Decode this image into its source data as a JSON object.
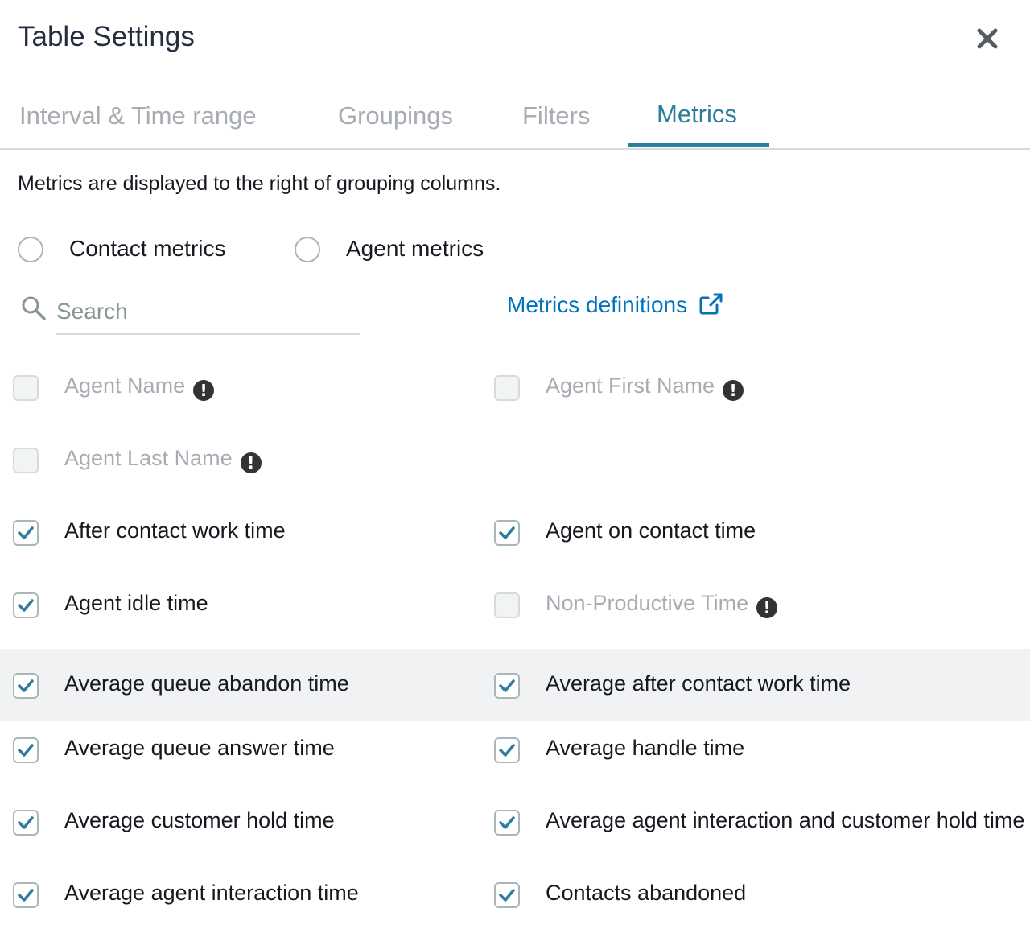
{
  "modal": {
    "title": "Table Settings",
    "close_icon": "close-icon"
  },
  "tabs": [
    {
      "label": "Interval & Time range",
      "active": false
    },
    {
      "label": "Groupings",
      "active": false
    },
    {
      "label": "Filters",
      "active": false
    },
    {
      "label": "Metrics",
      "active": true
    }
  ],
  "description": "Metrics are displayed to the right of grouping columns.",
  "metric_type": {
    "options": [
      {
        "label": "Contact metrics",
        "selected": false
      },
      {
        "label": "Agent metrics",
        "selected": false
      }
    ]
  },
  "search": {
    "placeholder": "Search",
    "value": ""
  },
  "definitions_link": {
    "label": "Metrics definitions",
    "icon": "external-link-icon"
  },
  "metrics": [
    {
      "label": "Agent Name",
      "checked": false,
      "disabled": true,
      "warning": true
    },
    {
      "label": "Agent First Name",
      "checked": false,
      "disabled": true,
      "warning": true
    },
    {
      "label": "Agent Last Name",
      "checked": false,
      "disabled": true,
      "warning": true
    },
    {
      "label": "After contact work time",
      "checked": true,
      "disabled": false,
      "warning": false
    },
    {
      "label": "Agent on contact time",
      "checked": true,
      "disabled": false,
      "warning": false
    },
    {
      "label": "Agent idle time",
      "checked": true,
      "disabled": false,
      "warning": false
    },
    {
      "label": "Non-Productive Time",
      "checked": false,
      "disabled": true,
      "warning": true
    },
    {
      "label": "Average queue abandon time",
      "checked": true,
      "disabled": false,
      "warning": false
    },
    {
      "label": "Average after contact work time",
      "checked": true,
      "disabled": false,
      "warning": false
    },
    {
      "label": "Average queue answer time",
      "checked": true,
      "disabled": false,
      "warning": false
    },
    {
      "label": "Average handle time",
      "checked": true,
      "disabled": false,
      "warning": false
    },
    {
      "label": "Average customer hold time",
      "checked": true,
      "disabled": false,
      "warning": false
    },
    {
      "label": "Average agent interaction and customer hold time",
      "checked": true,
      "disabled": false,
      "warning": false
    },
    {
      "label": "Average agent interaction time",
      "checked": true,
      "disabled": false,
      "warning": false
    },
    {
      "label": "Contacts abandoned",
      "checked": true,
      "disabled": false,
      "warning": false
    }
  ],
  "colors": {
    "accent": "#2e7d9a",
    "link": "#0073bb",
    "disabled_text": "#a7acb2",
    "highlight_row": "#f1f2f3"
  }
}
